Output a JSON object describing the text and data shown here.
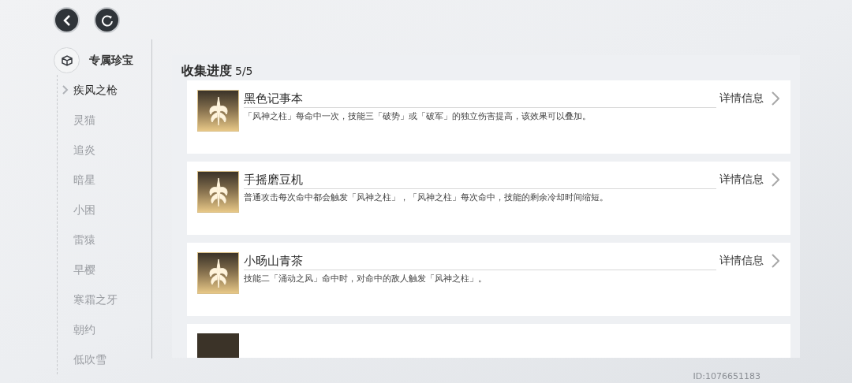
{
  "sidebar": {
    "title": "专属珍宝",
    "items": [
      {
        "label": "疾风之枪",
        "selected": true
      },
      {
        "label": "灵猫",
        "selected": false
      },
      {
        "label": "追炎",
        "selected": false
      },
      {
        "label": "暗星",
        "selected": false
      },
      {
        "label": "小困",
        "selected": false
      },
      {
        "label": "雷猿",
        "selected": false
      },
      {
        "label": "早樱",
        "selected": false
      },
      {
        "label": "寒霜之牙",
        "selected": false
      },
      {
        "label": "朝约",
        "selected": false
      },
      {
        "label": "低吹雪",
        "selected": false
      }
    ]
  },
  "panel": {
    "title": "收集进度",
    "count": "5/5",
    "cards": [
      {
        "title": "黑色记事本",
        "description": "「风神之柱」每命中一次，技能三「破势」或「破军」的独立伤害提高，该效果可以叠加。",
        "detail_label": "详情信息"
      },
      {
        "title": "手摇磨豆机",
        "description": "普通攻击每次命中都会触发「风神之柱」，「风神之柱」每次命中，技能的剩余冷却时间缩短。",
        "detail_label": "详情信息"
      },
      {
        "title": "小旸山青茶",
        "description": "技能二「涌动之风」命中时，对命中的敌人触发「风神之柱」。",
        "detail_label": "详情信息"
      }
    ]
  },
  "user_id": "ID:1076651183"
}
